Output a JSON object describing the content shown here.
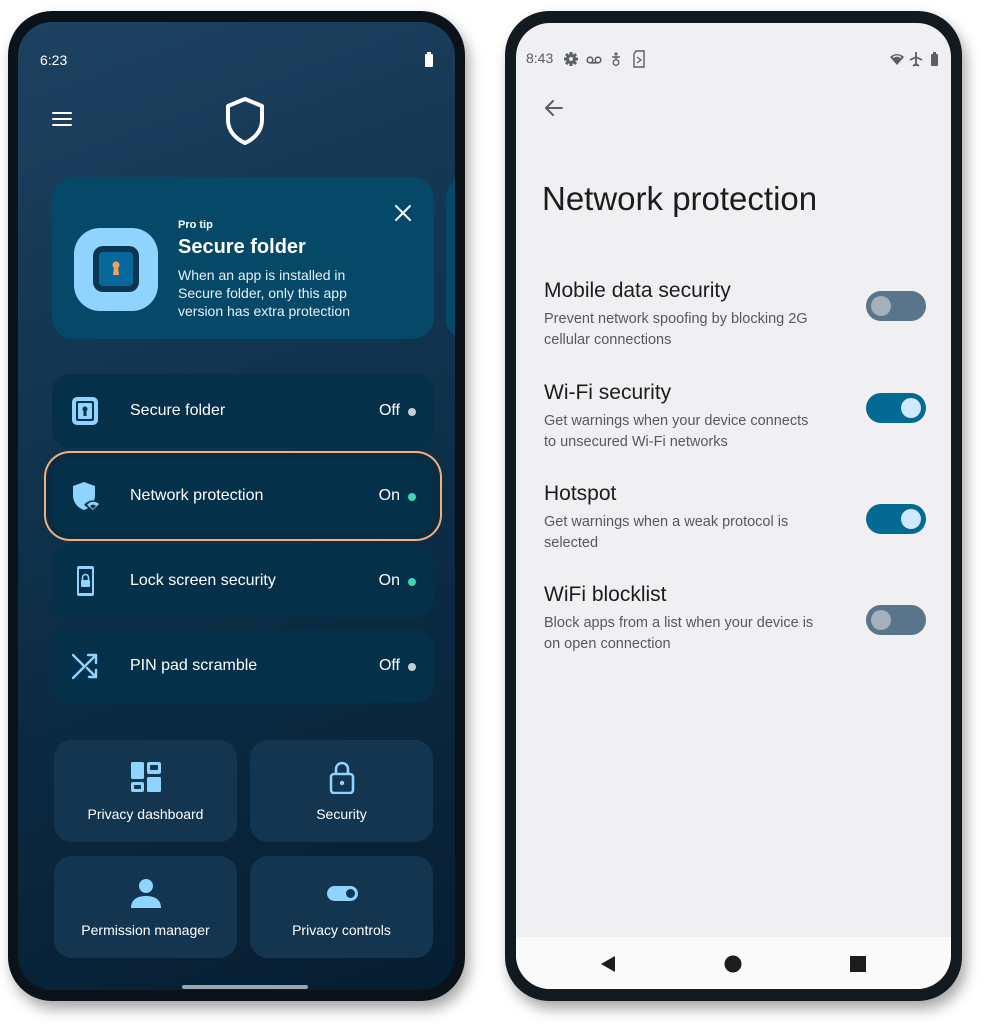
{
  "left_phone": {
    "status_bar": {
      "time": "6:23",
      "battery_icon": "battery-full-icon"
    },
    "header": {
      "menu_icon": "hamburger-menu-icon",
      "logo_icon": "shield-logo-icon"
    },
    "pro_tip": {
      "label": "Pro tip",
      "title": "Secure folder",
      "body": "When an app is installed in Secure folder, only this app version has extra protection",
      "icon": "secure-folder-keyhole-icon",
      "close_icon": "close-icon"
    },
    "features": [
      {
        "label": "Secure folder",
        "status": "Off",
        "icon": "secure-folder-icon",
        "state_color": "#c9cdd2",
        "highlighted": false
      },
      {
        "label": "Network protection",
        "status": "On",
        "icon": "shield-wifi-icon",
        "state_color": "#3fd6b3",
        "highlighted": true
      },
      {
        "label": "Lock screen security",
        "status": "On",
        "icon": "phone-lock-icon",
        "state_color": "#3fd6b3",
        "highlighted": false
      },
      {
        "label": "PIN pad scramble",
        "status": "Off",
        "icon": "shuffle-icon",
        "state_color": "#c9cdd2",
        "highlighted": false
      }
    ],
    "tiles": [
      {
        "label": "Privacy dashboard",
        "icon": "dashboard-icon"
      },
      {
        "label": "Security",
        "icon": "lock-icon"
      },
      {
        "label": "Permission manager",
        "icon": "person-icon"
      },
      {
        "label": "Privacy controls",
        "icon": "toggle-icon"
      }
    ]
  },
  "right_phone": {
    "status_bar": {
      "time": "8:43",
      "left_icons": [
        "settings-gear-icon",
        "voicemail-icon",
        "accessibility-icon",
        "sim-card-icon"
      ],
      "right_icons": [
        "wifi-icon",
        "airplane-mode-icon",
        "battery-icon"
      ]
    },
    "back_icon": "back-arrow-icon",
    "title": "Network protection",
    "settings": [
      {
        "title": "Mobile data security",
        "description": "Prevent network spoofing by blocking 2G cellular connections",
        "enabled": false
      },
      {
        "title": "Wi-Fi security",
        "description": "Get warnings when your device connects to unsecured Wi-Fi networks",
        "enabled": true
      },
      {
        "title": "Hotspot",
        "description": "Get warnings when a weak protocol is selected",
        "enabled": true
      },
      {
        "title": "WiFi blocklist",
        "description": "Block apps from a list when your device is on open connection",
        "enabled": false
      }
    ],
    "nav_bar": {
      "back": "nav-back-icon",
      "home": "nav-home-icon",
      "recents": "nav-recents-icon"
    }
  },
  "colors": {
    "accent_light_blue": "#8fd3ff",
    "highlight_outline": "#f0b07d",
    "toggle_on": "#046a94",
    "toggle_off": "#5a7489",
    "status_on": "#3fd6b3",
    "status_off": "#c9cdd2"
  }
}
